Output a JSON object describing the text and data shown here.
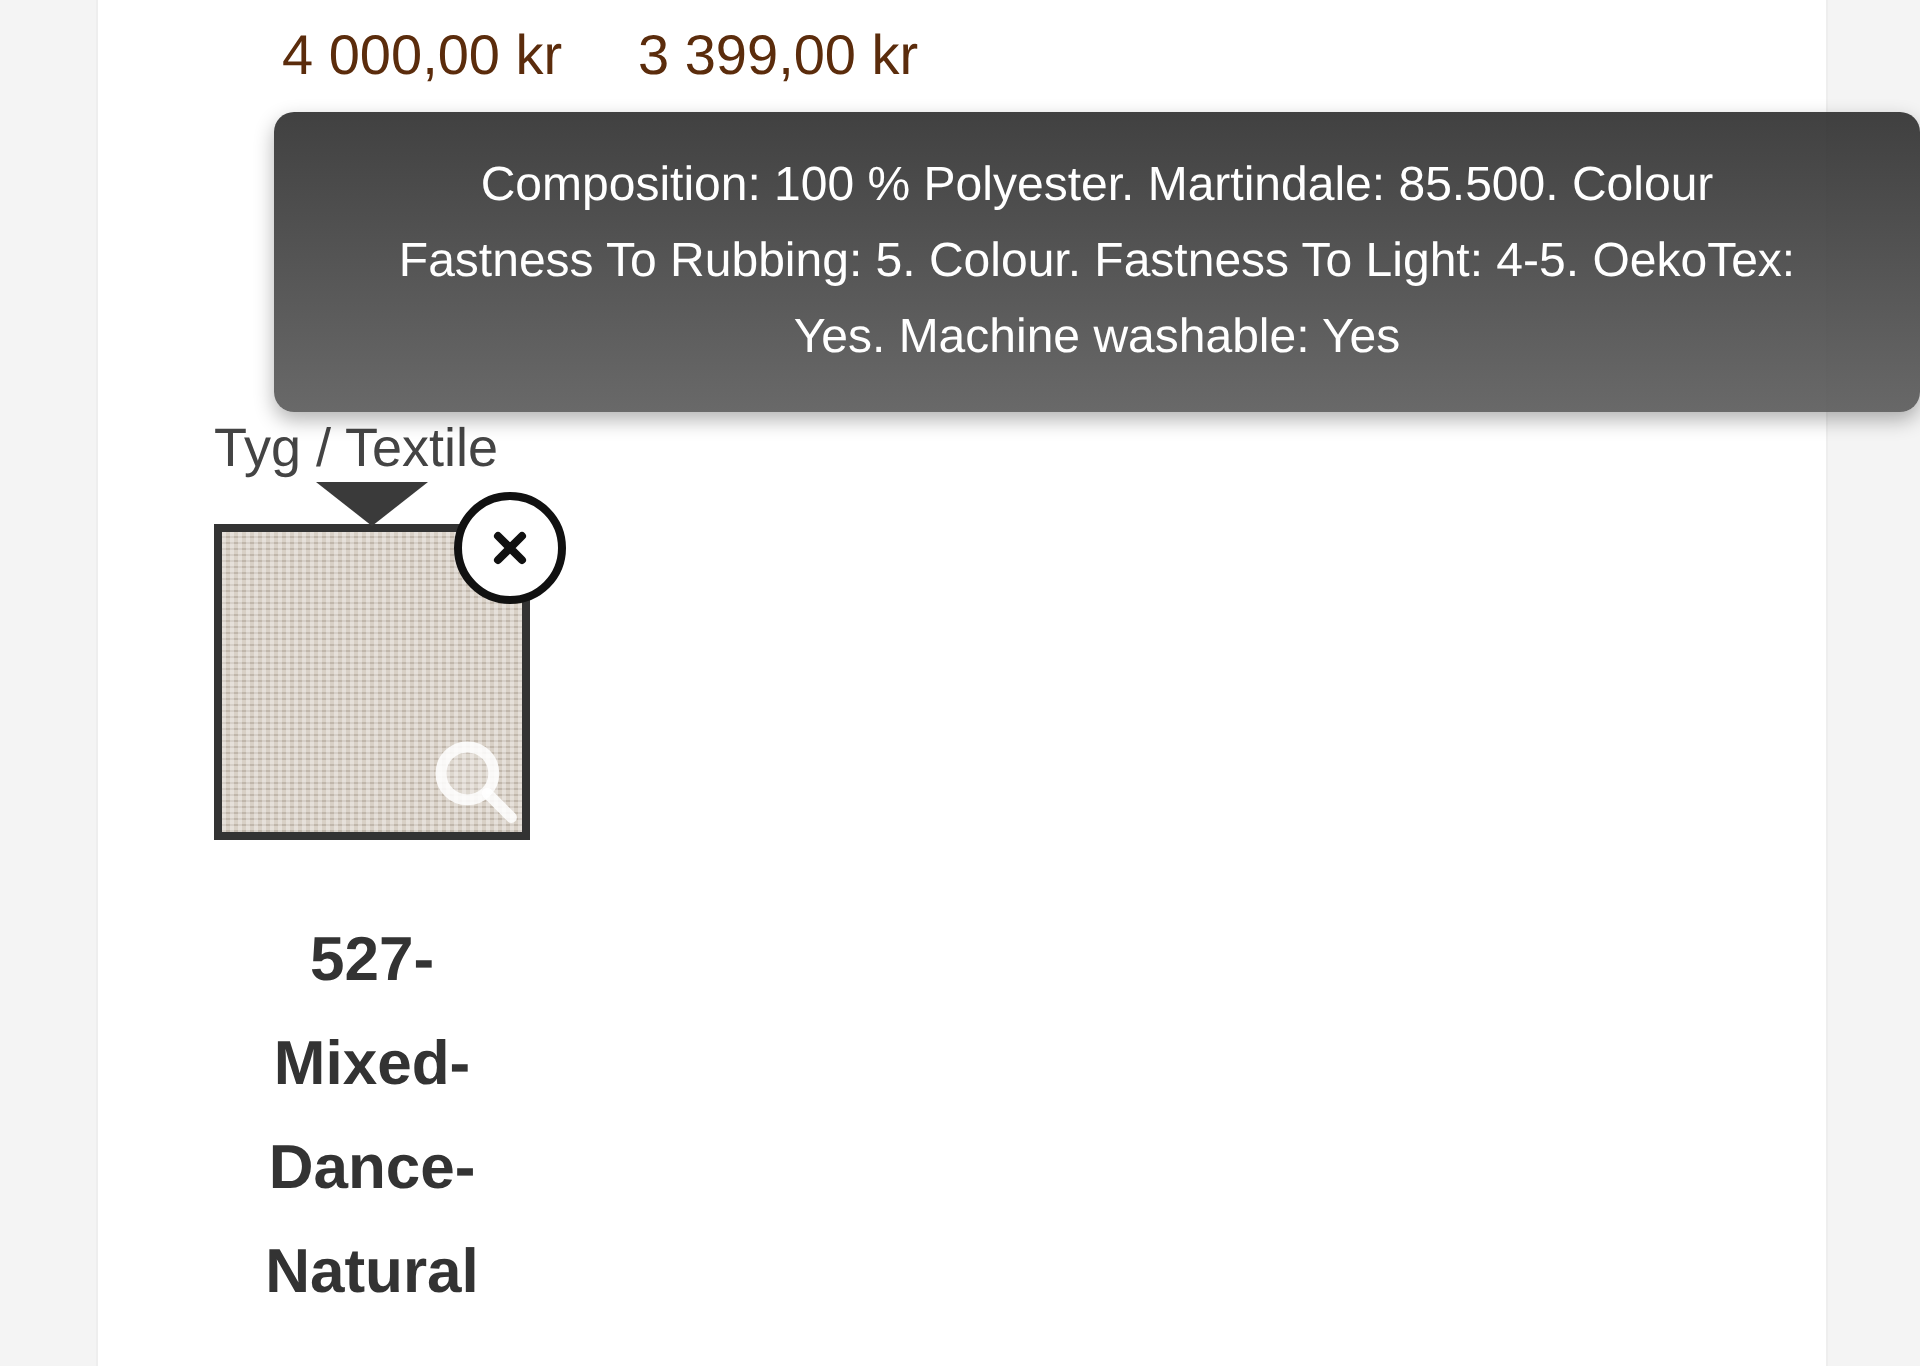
{
  "prices": [
    "4 000,00 kr",
    "3 399,00 kr"
  ],
  "tooltip": {
    "text": "Composition: 100 % Polyester. Martindale: 85.500. Colour Fastness To Rubbing: 5. Colour. Fastness To Light: 4-5. OekoTex: Yes. Machine washable: Yes"
  },
  "option_label": "Tyg / Textile",
  "swatch": {
    "name": "527-Mixed-Dance-Natural"
  }
}
